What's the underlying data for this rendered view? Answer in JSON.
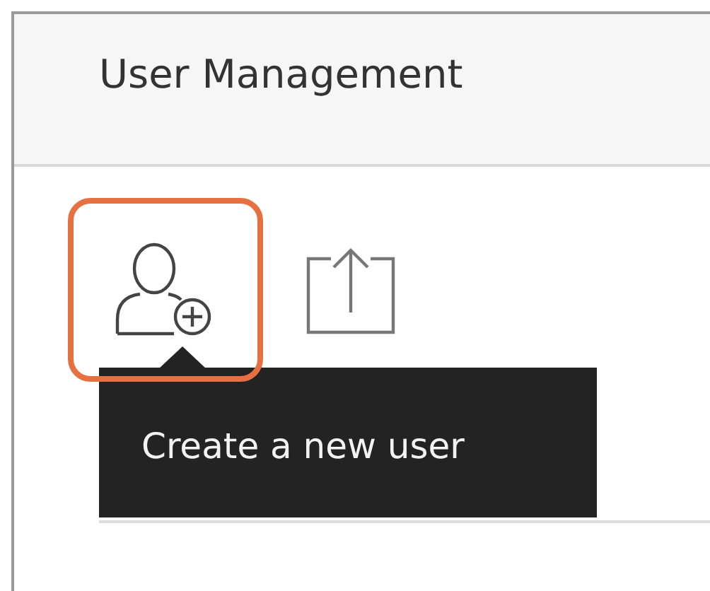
{
  "header": {
    "title": "User Management"
  },
  "toolbar": [
    {
      "kind": "add-user",
      "selected": true
    },
    {
      "kind": "upload",
      "selected": false
    }
  ],
  "tooltip": {
    "text": "Create a new user"
  }
}
